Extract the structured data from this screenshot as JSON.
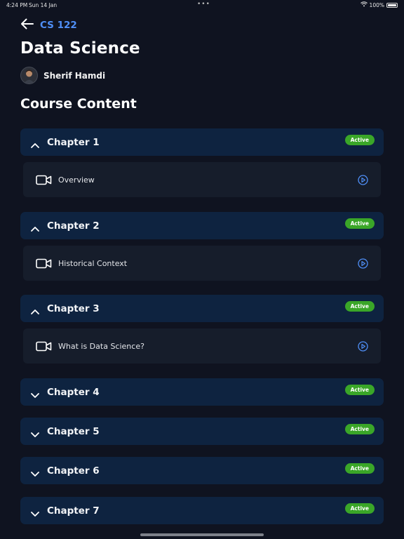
{
  "status_bar": {
    "time": "4:24 PM",
    "date": "Sun 14 Jan",
    "dots": "•••",
    "battery": "100%",
    "battery_level": 1.0
  },
  "nav": {
    "back_label": "CS 122"
  },
  "course": {
    "title": "Data Science",
    "instructor": "Sherif Hamdi"
  },
  "section": {
    "title": "Course Content"
  },
  "chapters": [
    {
      "title": "Chapter 1",
      "status": "Active",
      "expanded": true,
      "lesson": "Overview"
    },
    {
      "title": "Chapter 2",
      "status": "Active",
      "expanded": true,
      "lesson": "Historical Context"
    },
    {
      "title": "Chapter 3",
      "status": "Active",
      "expanded": true,
      "lesson": "What is Data Science?"
    },
    {
      "title": "Chapter 4",
      "status": "Active",
      "expanded": false
    },
    {
      "title": "Chapter 5",
      "status": "Active",
      "expanded": false
    },
    {
      "title": "Chapter 6",
      "status": "Active",
      "expanded": false
    },
    {
      "title": "Chapter 7",
      "status": "Active",
      "expanded": false
    }
  ],
  "colors": {
    "accent": "#4f8ff7",
    "badge": "#3aa628",
    "chapter_bg": "#0e2340",
    "lesson_bg": "#161d2b",
    "page_bg": "#0f1320"
  },
  "icons": {
    "back": "arrow-left-icon",
    "expanded": "chevron-up-icon",
    "collapsed": "chevron-down-icon",
    "lesson": "video-camera-icon",
    "play": "play-circle-icon"
  }
}
